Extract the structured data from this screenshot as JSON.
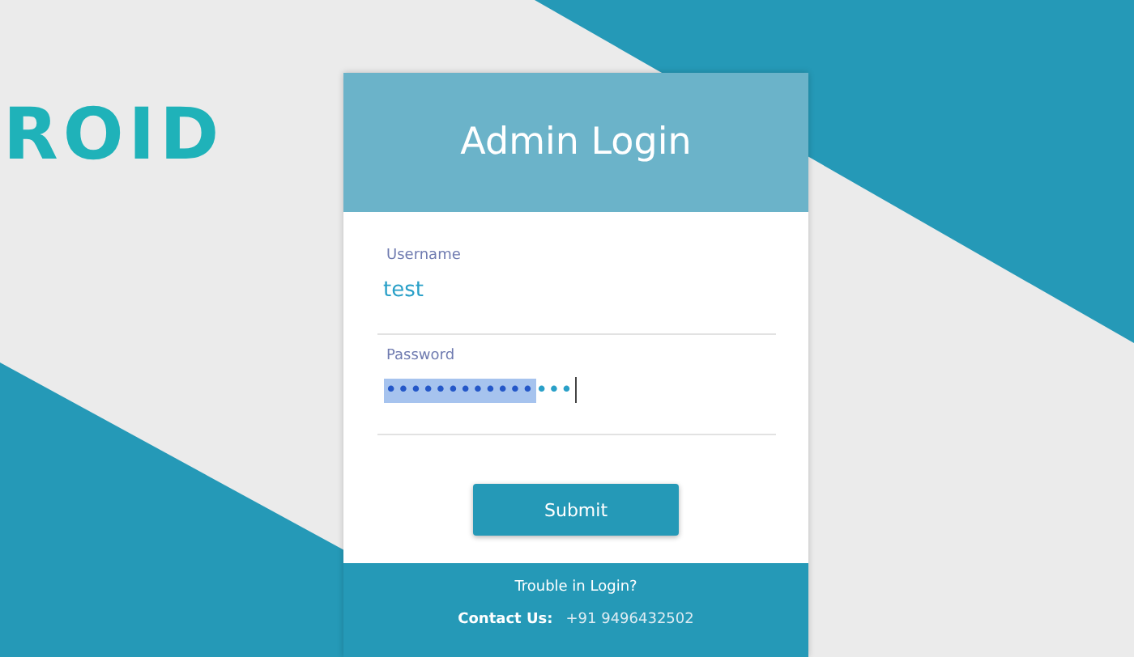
{
  "logo": {
    "text": "ROID"
  },
  "login": {
    "title": "Admin Login",
    "fields": [
      {
        "label": "Username",
        "value": "test"
      },
      {
        "label": "Password",
        "value": "•••",
        "selected_part": "••••••••••••"
      }
    ],
    "submit": "Submit",
    "footer": {
      "trouble": "Trouble in Login?",
      "contact_label": "Contact Us:",
      "contact_value": "+91 9496432502"
    }
  }
}
